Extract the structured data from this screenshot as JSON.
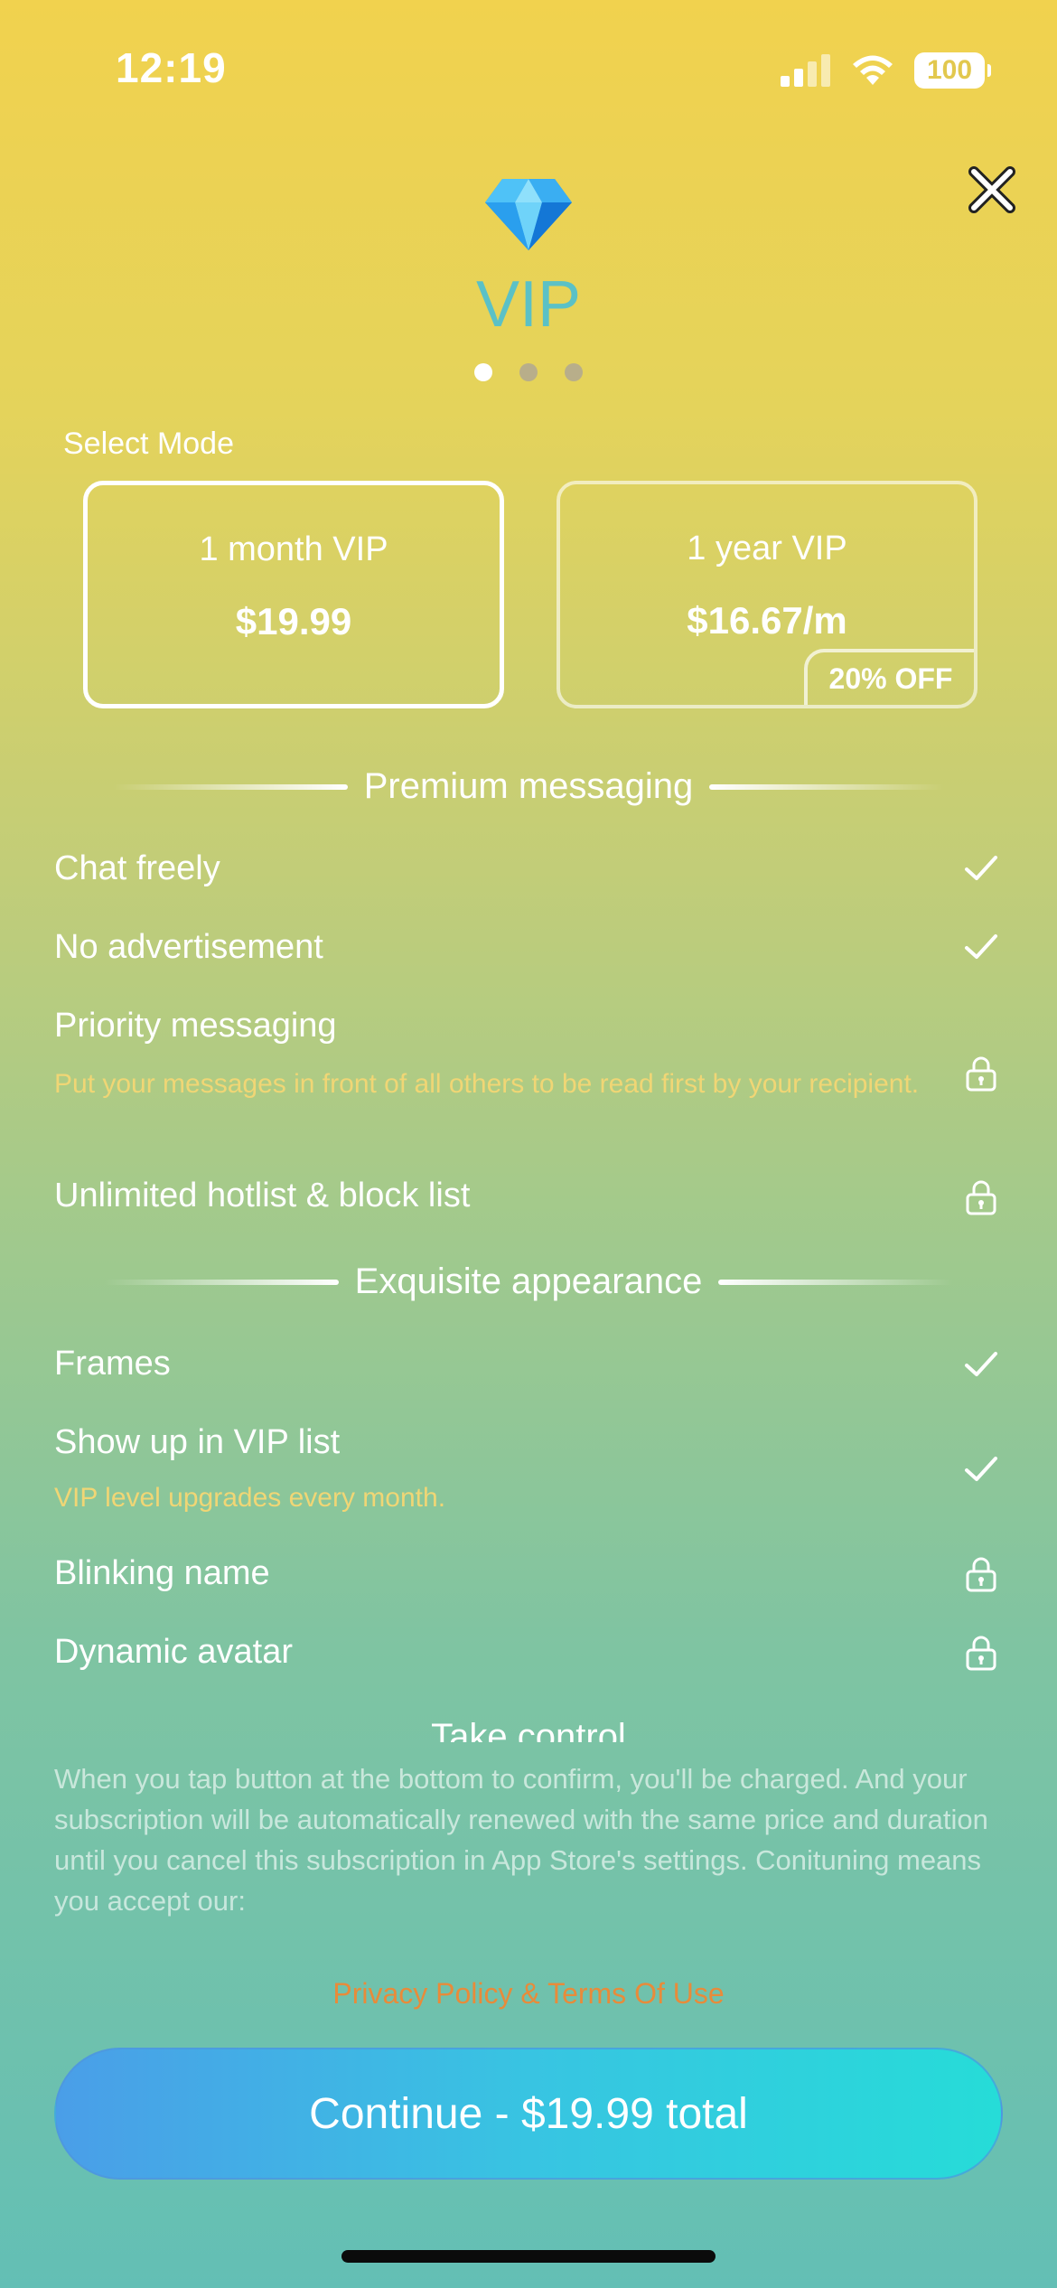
{
  "status_bar": {
    "time": "12:19",
    "battery": "100",
    "signal_icon": "signal-icon",
    "wifi_icon": "wifi-icon"
  },
  "header": {
    "title": "VIP",
    "icon": "diamond-icon",
    "close_icon": "close-icon",
    "page_count": 3,
    "active_page": 1
  },
  "select_mode": {
    "label": "Select Mode",
    "plans": [
      {
        "name": "1 month VIP",
        "price": "$19.99",
        "selected": true
      },
      {
        "name": "1 year VIP",
        "price": "$16.67/m",
        "badge": "20% OFF",
        "selected": false
      }
    ]
  },
  "sections": [
    {
      "title": "Premium messaging",
      "features": [
        {
          "name": "Chat freely",
          "status": "check"
        },
        {
          "name": "No advertisement",
          "status": "check"
        },
        {
          "name": "Priority messaging",
          "desc": "Put your messages in front of all others to be read first by your recipient.",
          "status": "lock"
        },
        {
          "name": "Unlimited hotlist & block list",
          "status": "lock"
        }
      ]
    },
    {
      "title": "Exquisite appearance",
      "features": [
        {
          "name": "Frames",
          "status": "check"
        },
        {
          "name": "Show up in VIP list",
          "desc": "VIP level upgrades every month.",
          "status": "check"
        },
        {
          "name": "Blinking name",
          "status": "lock"
        },
        {
          "name": "Dynamic avatar",
          "status": "lock"
        }
      ]
    },
    {
      "title": "Take control"
    }
  ],
  "legal": {
    "text": "When you tap button at the bottom to confirm, you'll be charged. And your subscription will be automatically renewed with the same price and duration until you cancel this subscription in App Store's settings. Conituning means you accept our:",
    "link": "Privacy Policy & Terms Of Use"
  },
  "cta": {
    "label": "Continue - $19.99 total"
  },
  "colors": {
    "title": "#5bc1c6",
    "desc": "#f0d675",
    "link": "#e88b3a",
    "cta_start": "#4a9ee8",
    "cta_end": "#26dcd8"
  }
}
